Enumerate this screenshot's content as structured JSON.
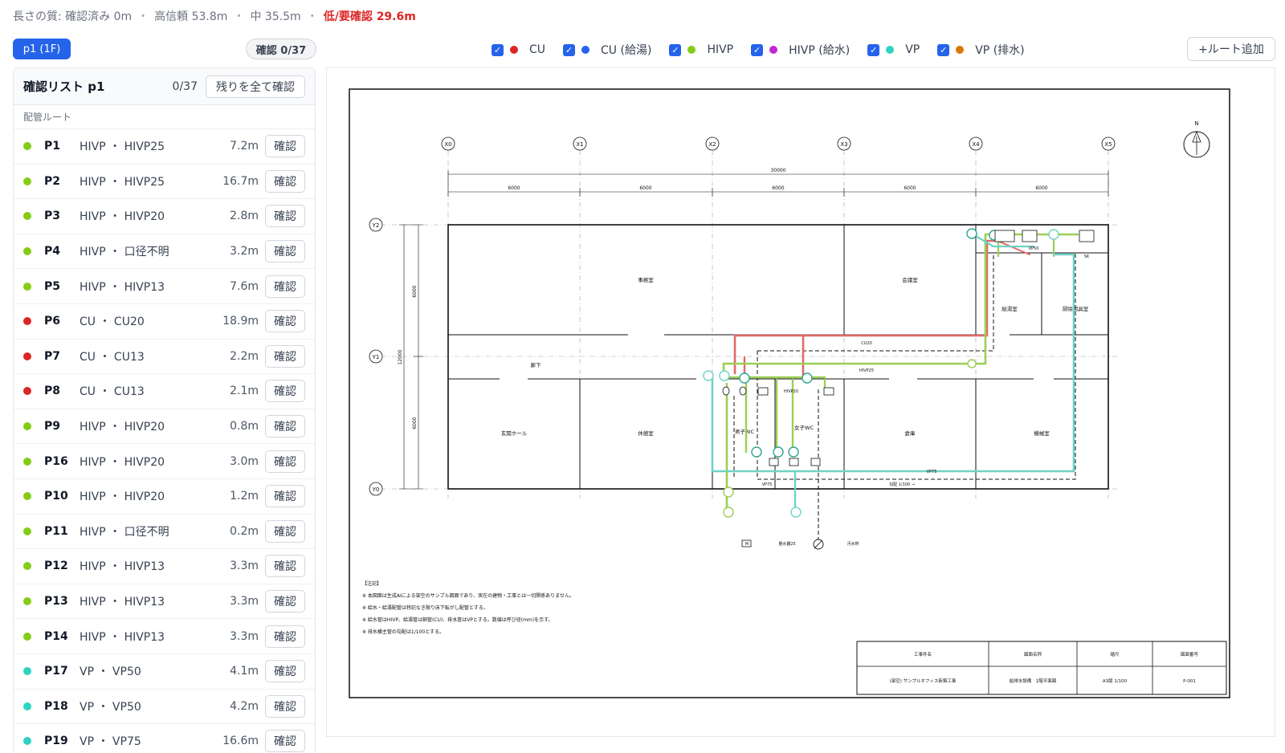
{
  "summary": {
    "label": "長さの質:",
    "confirmed": "確認済み 0m",
    "high": "高信頼 53.8m",
    "medium": "中 35.5m",
    "low": "低/要確認 29.6m"
  },
  "floor_badge": "p1 (1F)",
  "confirm_badge": "確認 0/37",
  "filters": [
    {
      "label": "CU",
      "color": "#dc2626"
    },
    {
      "label": "CU (給湯)",
      "color": "#2563eb"
    },
    {
      "label": "HIVP",
      "color": "#84cc16"
    },
    {
      "label": "HIVP (給水)",
      "color": "#c026d3"
    },
    {
      "label": "VP",
      "color": "#2dd4bf"
    },
    {
      "label": "VP (排水)",
      "color": "#d97706"
    }
  ],
  "add_route": "+ルート追加",
  "list": {
    "title": "確認リスト p1",
    "count": "0/37",
    "confirm_all": "残りを全て確認",
    "section": "配管ルート",
    "button": "確認",
    "rows": [
      {
        "id": "P1",
        "desc": "HIVP ・ HIVP25",
        "len": "7.2m",
        "color": "#84cc16"
      },
      {
        "id": "P2",
        "desc": "HIVP ・ HIVP25",
        "len": "16.7m",
        "color": "#84cc16"
      },
      {
        "id": "P3",
        "desc": "HIVP ・ HIVP20",
        "len": "2.8m",
        "color": "#84cc16"
      },
      {
        "id": "P4",
        "desc": "HIVP ・ 口径不明",
        "len": "3.2m",
        "color": "#84cc16"
      },
      {
        "id": "P5",
        "desc": "HIVP ・ HIVP13",
        "len": "7.6m",
        "color": "#84cc16"
      },
      {
        "id": "P6",
        "desc": "CU ・ CU20",
        "len": "18.9m",
        "color": "#dc2626"
      },
      {
        "id": "P7",
        "desc": "CU ・ CU13",
        "len": "2.2m",
        "color": "#dc2626"
      },
      {
        "id": "P8",
        "desc": "CU ・ CU13",
        "len": "2.1m",
        "color": "#dc2626"
      },
      {
        "id": "P9",
        "desc": "HIVP ・ HIVP20",
        "len": "0.8m",
        "color": "#84cc16"
      },
      {
        "id": "P16",
        "desc": "HIVP ・ HIVP20",
        "len": "3.0m",
        "color": "#84cc16"
      },
      {
        "id": "P10",
        "desc": "HIVP ・ HIVP20",
        "len": "1.2m",
        "color": "#84cc16"
      },
      {
        "id": "P11",
        "desc": "HIVP ・ 口径不明",
        "len": "0.2m",
        "color": "#84cc16"
      },
      {
        "id": "P12",
        "desc": "HIVP ・ HIVP13",
        "len": "3.3m",
        "color": "#84cc16"
      },
      {
        "id": "P13",
        "desc": "HIVP ・ HIVP13",
        "len": "3.3m",
        "color": "#84cc16"
      },
      {
        "id": "P14",
        "desc": "HIVP ・ HIVP13",
        "len": "3.3m",
        "color": "#84cc16"
      },
      {
        "id": "P17",
        "desc": "VP ・ VP50",
        "len": "4.1m",
        "color": "#2dd4bf"
      },
      {
        "id": "P18",
        "desc": "VP ・ VP50",
        "len": "4.2m",
        "color": "#2dd4bf"
      },
      {
        "id": "P19",
        "desc": "VP ・ VP75",
        "len": "16.6m",
        "color": "#2dd4bf"
      }
    ]
  },
  "drawing": {
    "grid_x": [
      "X0",
      "X1",
      "X2",
      "X3",
      "X4",
      "X5"
    ],
    "grid_y": [
      "Y2",
      "Y1",
      "Y0"
    ],
    "dim_total": "30000",
    "dim_span": "6000",
    "dim_v_total": "12000",
    "rooms": {
      "office": "事務室",
      "meeting": "会議室",
      "corridor": "廊下",
      "entrance": "玄関ホール",
      "break": "休憩室",
      "storage": "倉庫",
      "machine": "機械室",
      "kitchen": "給湯室",
      "cleaning": "掃除用具室",
      "mens_wc": "男子WC",
      "womens_wc": "女子WC"
    },
    "pipe_labels": {
      "cu20": "CU20",
      "hivp25": "HIVP25",
      "hivp20": "HIVP20",
      "vp75a": "VP75",
      "vp75b": "VP75",
      "vp50": "VP50",
      "slope": "勾配 1/100 →",
      "sk": "SK",
      "meter": "M",
      "water_main": "量水器25",
      "sewer": "汚水桝"
    },
    "north": "N",
    "notes": [
      "【注記】",
      "※ 本図面は生成AIによる架空のサンプル図面であり、実在の建物・工事とは一切関係ありません。",
      "※ 給水・給湯配管は特記なき限り床下転がし配管とする。",
      "※ 給水管はHIVP、給湯管は銅管(CU)、排水管はVPとする。数値は呼び径(mm)を示す。",
      "※ 排水横主管の勾配は1/100とする。"
    ],
    "title_block": {
      "h_project": "工事件名",
      "h_drawing": "図面名称",
      "h_scale": "縮尺",
      "h_number": "図面番号",
      "project": "(架空) サンプルオフィス新築工事",
      "drawing": "給排水設備　1階平面図",
      "scale": "A3版 1/100",
      "number": "P-001"
    }
  }
}
